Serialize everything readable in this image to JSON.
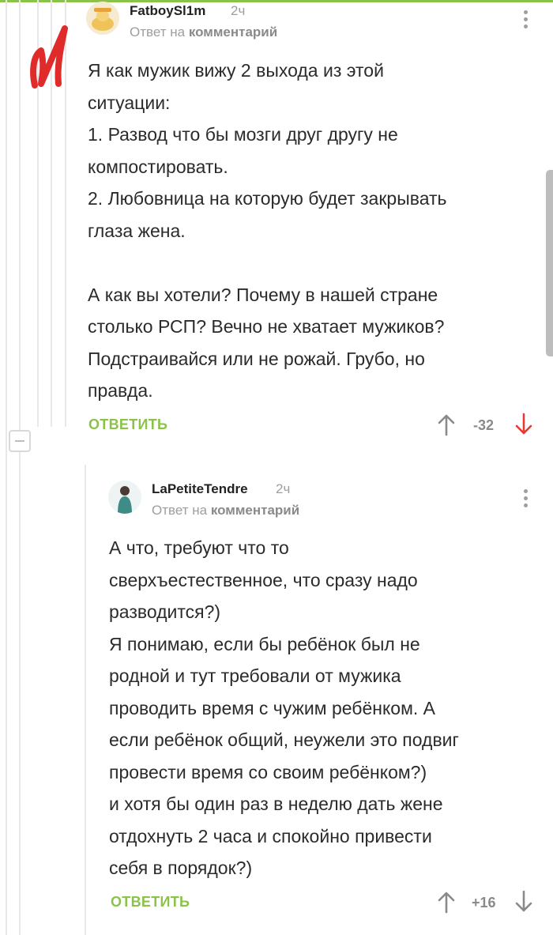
{
  "thread": {
    "comments": [
      {
        "author": "FatboySl1m",
        "time": "2ч",
        "reply_prefix": "Ответ на",
        "reply_target": "комментарий",
        "text": "Я как мужик вижу 2 выхода из этой\nситуации:\n1. Развод что бы мозги друг другу не\nкомпостировать.\n2. Любовница на которую будет закрывать\nглаза жена.\n\nА как вы хотели? Почему в нашей стране\nстолько РСП? Вечно не хватает мужиков?\nПодстраивайся или не рожай. Грубо, но\nправда.",
        "reply_label": "ОТВЕТИТЬ",
        "rating": "-32"
      },
      {
        "author": "LaPetiteTendre",
        "time": "2ч",
        "reply_prefix": "Ответ на",
        "reply_target": "комментарий",
        "text": "А что, требуют что то\nсверхъестественное, что сразу надо\nразводится?)\nЯ понимаю, если бы ребёнок был не\nродной и тут требовали от мужика\nпроводить время с чужим ребёнком. А\nесли ребёнок общий, неужели это подвиг\nпровести время со своим ребёнком?)\nи хотя бы один раз в неделю дать жене\nотдохнуть 2 часа и спокойно привести\nсебя в порядок?)",
        "reply_label": "ОТВЕТИТЬ",
        "rating": "+16"
      }
    ]
  },
  "icons": {
    "upvote": "arrow-up-icon",
    "downvote": "arrow-down-icon",
    "more": "more-vertical-icon",
    "collapse": "minus-icon",
    "brand_mark": "red-rating-mark"
  },
  "colors": {
    "accent": "#8bc34a",
    "downvote_active": "#e53935",
    "text": "#2b2b2b",
    "muted": "#9e9e9e",
    "thread_line": "#e8e8e8"
  }
}
